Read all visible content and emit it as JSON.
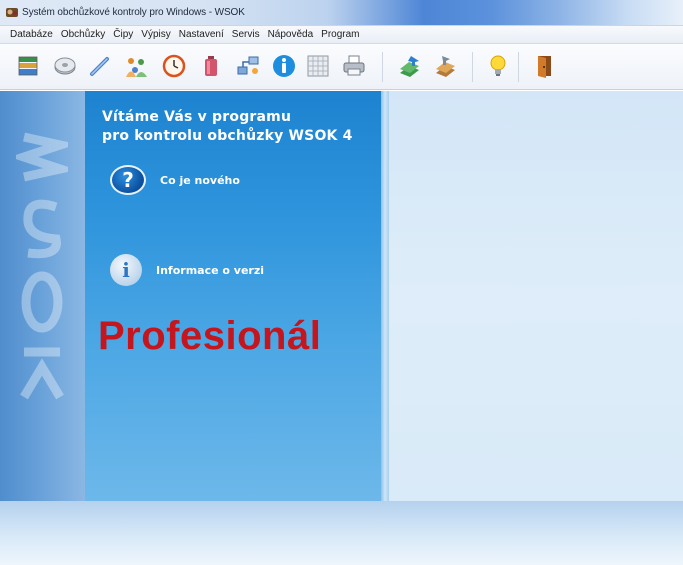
{
  "window": {
    "title": "Systém obchůzkové kontroly pro Windows - WSOK",
    "app_icon": "app-icon"
  },
  "menu": {
    "items": [
      "Databáze",
      "Obchůzky",
      "Čipy",
      "Výpisy",
      "Nastavení",
      "Servis",
      "Nápověda",
      "Program"
    ]
  },
  "toolbar": {
    "buttons": [
      {
        "icon": "books-icon"
      },
      {
        "icon": "disc-icon"
      },
      {
        "icon": "wand-icon"
      },
      {
        "icon": "people-icon"
      },
      {
        "icon": "clock-icon"
      },
      {
        "icon": "battery-icon"
      },
      {
        "icon": "network-icon"
      },
      {
        "icon": "info-icon"
      },
      {
        "icon": "grid-icon"
      },
      {
        "icon": "printer-icon"
      },
      {
        "icon": "export-icon"
      },
      {
        "icon": "import-icon"
      },
      {
        "icon": "lightbulb-icon"
      },
      {
        "icon": "exit-door-icon"
      }
    ]
  },
  "welcome": {
    "line1": "Vítáme Vás v programu",
    "line2": "pro kontrolu obchůzky WSOK 4"
  },
  "links": {
    "whats_new": {
      "icon": "question-icon",
      "label": "Co je nového"
    },
    "version_info": {
      "icon": "info-circle-icon",
      "label": "Informace o verzi"
    }
  },
  "edition": "Profesionál",
  "colors": {
    "panel": "#2e94dc",
    "edition_text": "#c4161c",
    "background": "#d7e9f9"
  }
}
